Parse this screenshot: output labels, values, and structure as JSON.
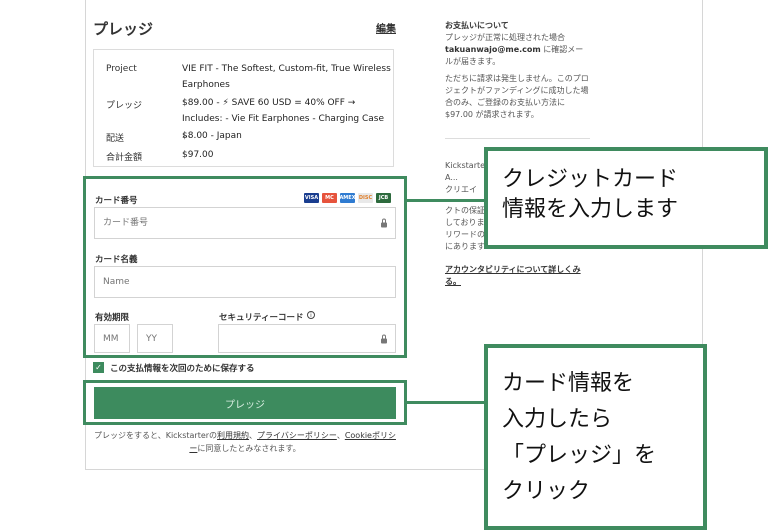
{
  "header": {
    "title": "プレッジ",
    "edit_label": "編集"
  },
  "summary": {
    "project_label": "Project",
    "project_value": "VIE FIT - The Softest, Custom-fit, True Wireless Earphones",
    "pledge_label": "プレッジ",
    "pledge_value": "$89.00 - ⚡ SAVE 60 USD = 40% OFF → Includes: - Vie Fit Earphones - Charging Case ...",
    "shipping_label": "配送",
    "shipping_value": "$8.00 - Japan",
    "total_label": "合計金額",
    "total_value": "$97.00"
  },
  "payment": {
    "card_number_label": "カード番号",
    "card_number_placeholder": "カード番号",
    "card_name_label": "カード名義",
    "card_name_placeholder": "Name",
    "expiry_label": "有効期限",
    "month_placeholder": "MM",
    "year_placeholder": "YY",
    "security_label": "セキュリティーコード",
    "card_brands": [
      "VISA",
      "MC",
      "AMEX",
      "DISC",
      "JCB"
    ],
    "save_label": "この支払情報を次回のために保存する",
    "pledge_button": "プレッジ",
    "terms_prefix": "プレッジをすると、Kickstarterの",
    "terms_link": "利用規約",
    "terms_sep": "、",
    "privacy_link": "プライバシーポリシー",
    "cookie_link": "Cookieポリシー",
    "terms_suffix": "に同意したとみなされます。"
  },
  "sidebar": {
    "payment_heading": "お支払いについて",
    "payment_text1": "プレッジが正常に処理された場合",
    "email": "takuanwajo@me.com",
    "payment_text2": "に確認メールが届きます。",
    "payment_text3": "ただちに請求は発生しません。このプロジェクトがファンディングに成功した場合のみ、ご登録のお支払い方法に $97.00 が請求されます。",
    "kick_line1": "Kickstarter",
    "kick_line2": "A...",
    "kick_line3": "クリエイ",
    "partial1": "クトの保証",
    "partial2": "しておりま",
    "partial3": "リワードの",
    "partial4": "にあります",
    "accountability_link": "アカウンタビリティについて詳しくみる。"
  },
  "callouts": {
    "top": "クレジットカード\n情報を入力します",
    "bottom": "カード情報を\n入力したら\n「プレッジ」を\nクリック"
  },
  "colors": {
    "accent": "#3d8b5e",
    "annotation": "#3f8b5f"
  }
}
